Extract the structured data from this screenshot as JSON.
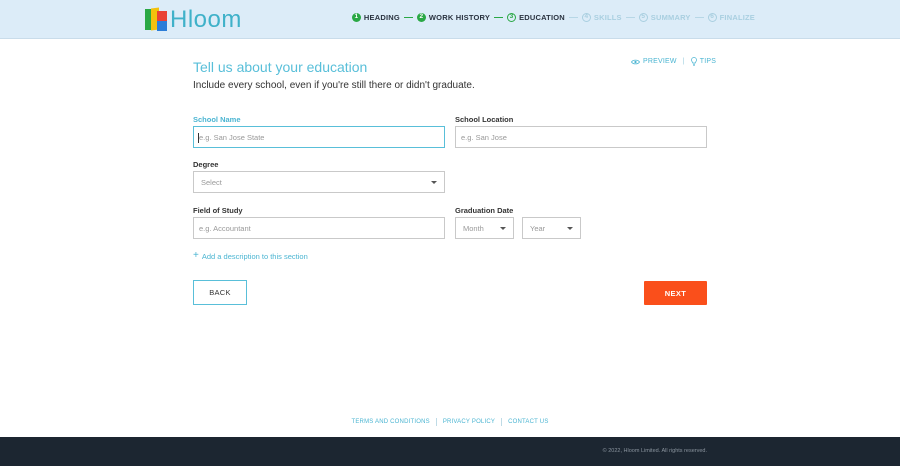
{
  "brand": {
    "name": "Hloom"
  },
  "steps": [
    {
      "num": "1",
      "label": "HEADING",
      "state": "done"
    },
    {
      "num": "2",
      "label": "WORK HISTORY",
      "state": "done"
    },
    {
      "num": "3",
      "label": "EDUCATION",
      "state": "active"
    },
    {
      "num": "4",
      "label": "SKILLS",
      "state": "todo"
    },
    {
      "num": "5",
      "label": "SUMMARY",
      "state": "todo"
    },
    {
      "num": "6",
      "label": "FINALIZE",
      "state": "todo"
    }
  ],
  "page": {
    "title": "Tell us about your education",
    "subtitle": "Include every school, even if you're still there or didn't graduate.",
    "preview_label": "PREVIEW",
    "tips_label": "TIPS"
  },
  "form": {
    "school_name": {
      "label": "School Name",
      "placeholder": "e.g. San Jose State",
      "value": ""
    },
    "school_location": {
      "label": "School Location",
      "placeholder": "e.g. San Jose",
      "value": ""
    },
    "degree": {
      "label": "Degree",
      "selected": "Select"
    },
    "field_of_study": {
      "label": "Field of Study",
      "placeholder": "e.g. Accountant",
      "value": ""
    },
    "graduation_date": {
      "label": "Graduation Date",
      "month": "Month",
      "year": "Year"
    },
    "add_description": "Add a description to this section"
  },
  "buttons": {
    "back": "BACK",
    "next": "NEXT"
  },
  "footer": {
    "links": [
      "TERMS AND CONDITIONS",
      "PRIVACY POLICY",
      "CONTACT US"
    ],
    "copyright": "© 2022, Hloom Limited. All rights reserved."
  },
  "colors": {
    "accent": "#59bfd9",
    "next_button": "#fa4f1b",
    "step_done": "#2aa845",
    "footer_bg": "#1c2631",
    "header_bg": "#dcecf8"
  }
}
